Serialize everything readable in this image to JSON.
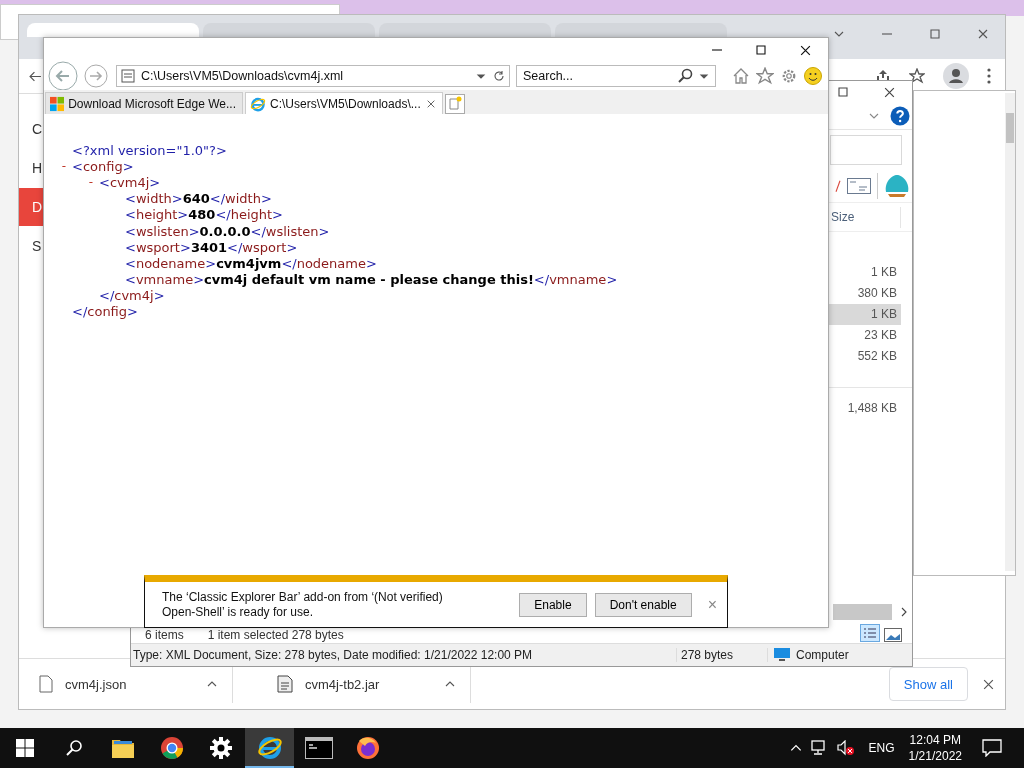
{
  "chrome": {
    "tabs": [
      {
        "selected": true
      },
      {
        "selected": false
      },
      {
        "selected": false
      },
      {
        "selected": false
      }
    ],
    "sidebar": [
      {
        "label": "C",
        "selected": false
      },
      {
        "label": "H",
        "selected": false
      },
      {
        "label": "D",
        "selected": true
      },
      {
        "label": "S",
        "selected": false
      }
    ],
    "downloads": [
      {
        "name": "cvm4j.json",
        "kind": "file"
      },
      {
        "name": "cvm4j-tb2.jar",
        "kind": "jar"
      }
    ],
    "show_all": "Show all"
  },
  "explorer": {
    "size_header": "Size",
    "sizes": [
      {
        "value": "1 KB",
        "selected": false
      },
      {
        "value": "380 KB",
        "selected": false
      },
      {
        "value": "1 KB",
        "selected": true
      },
      {
        "value": "23 KB",
        "selected": false
      },
      {
        "value": "552 KB",
        "selected": false
      }
    ],
    "other_sizes": [
      {
        "value": "1,488 KB",
        "selected": false
      }
    ],
    "item_count": "6 items",
    "selection": "1 item selected  278 bytes",
    "details": "Type: XML Document, Size: 278 bytes, Date modified: 1/21/2022 12:00 PM",
    "size": "278 bytes",
    "location": "Computer"
  },
  "ie": {
    "address": "C:\\Users\\VM5\\Downloads\\cvm4j.xml",
    "search_placeholder": "Search...",
    "tabs": [
      {
        "label": "Download Microsoft Edge We...",
        "kind": "windows",
        "selected": false
      },
      {
        "label": "C:\\Users\\VM5\\Downloads\\...",
        "kind": "ie",
        "selected": true
      }
    ],
    "xml": {
      "declaration": "<?xml version=\"1.0\"?>",
      "root": {
        "toggle": "-",
        "expanded": true,
        "open": "<config>",
        "close": "</config>",
        "children": [
          {
            "toggle": "-",
            "expanded": true,
            "open": "<cvm4j>",
            "close": "</cvm4j>",
            "children": [
              {
                "open": "<width>",
                "value": "640",
                "close": "</width>"
              },
              {
                "open": "<height>",
                "value": "480",
                "close": "</height>"
              },
              {
                "open": "<wslisten>",
                "value": "0.0.0.0",
                "close": "</wslisten>"
              },
              {
                "open": "<wsport>",
                "value": "3401",
                "close": "</wsport>"
              },
              {
                "open": "<nodename>",
                "value": "cvm4jvm",
                "close": "</nodename>"
              },
              {
                "open": "<vmname>",
                "value": "cvm4j default vm name - please change this!",
                "close": "</vmname>"
              }
            ]
          }
        ]
      }
    },
    "notification": {
      "message_lines": [
        "The ‘Classic Explorer Bar’ add-on from ‘(Not verified)",
        "Open-Shell’ is ready for use."
      ],
      "buttons": [
        "Enable",
        "Don't enable"
      ],
      "close": "×"
    }
  },
  "taskbar": {
    "apps": [
      {
        "kind": "explorer",
        "selected": false
      },
      {
        "kind": "chrome",
        "selected": false
      },
      {
        "kind": "settings",
        "selected": false
      },
      {
        "kind": "ie",
        "selected": true
      },
      {
        "kind": "terminal",
        "selected": false
      },
      {
        "kind": "firefox",
        "selected": false
      }
    ],
    "language": "ENG",
    "time": "12:04 PM",
    "date": "1/21/2022"
  }
}
